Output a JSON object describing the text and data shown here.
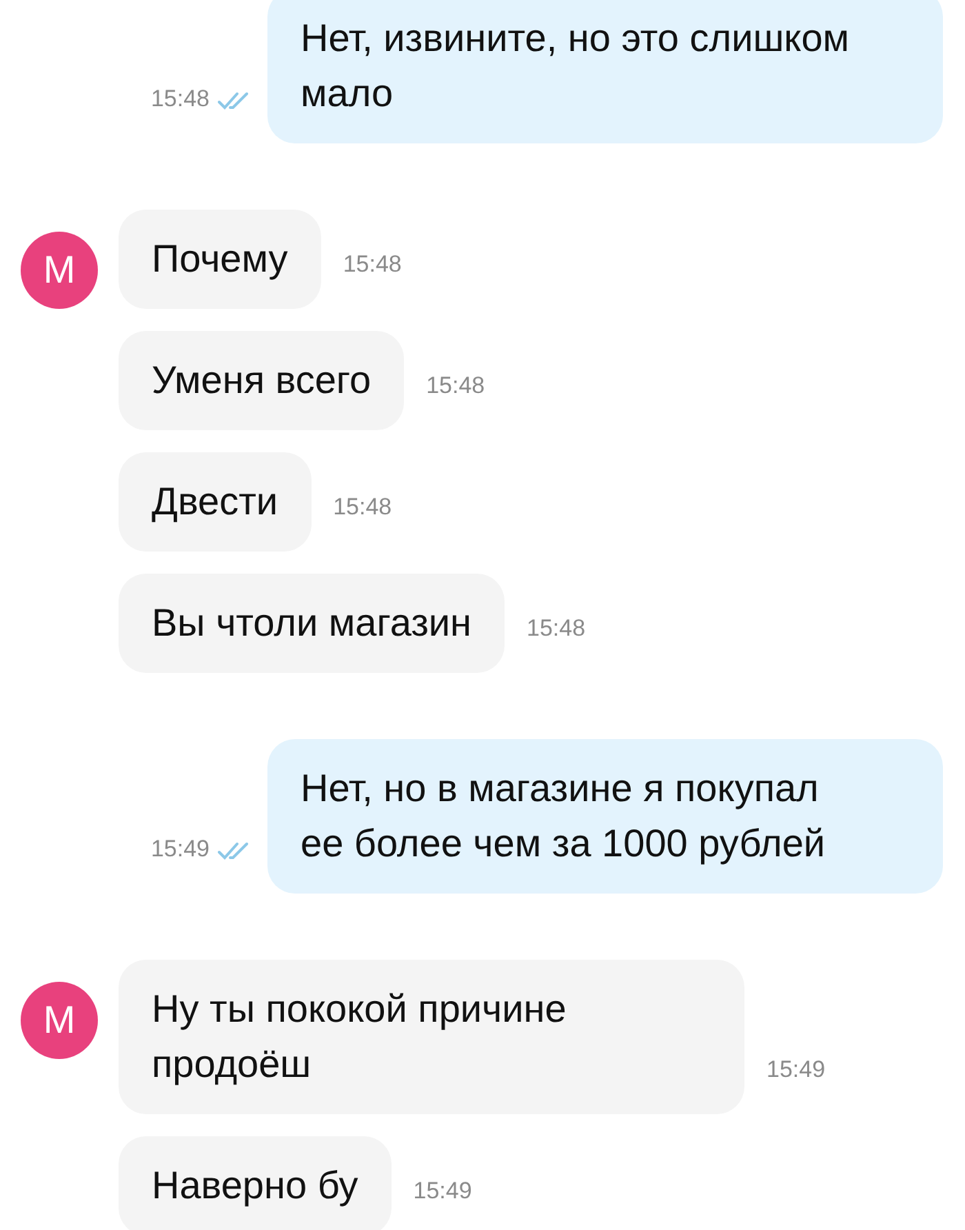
{
  "messages_groups": [
    {
      "kind": "outgoing",
      "messages": [
        {
          "text": "Нет, извините, но это слишком мало",
          "time": "15:48",
          "read": true
        }
      ]
    },
    {
      "kind": "incoming",
      "avatar": "M",
      "messages": [
        {
          "text": "Почему",
          "time": "15:48"
        },
        {
          "text": "Уменя всего",
          "time": "15:48"
        },
        {
          "text": "Двести",
          "time": "15:48"
        },
        {
          "text": "Вы чтоли магазин",
          "time": "15:48"
        }
      ]
    },
    {
      "kind": "outgoing",
      "messages": [
        {
          "text": "Нет, но в магазине я покупал ее более чем за 1000 рублей",
          "time": "15:49",
          "read": true
        }
      ]
    },
    {
      "kind": "incoming",
      "avatar": "M",
      "messages": [
        {
          "text": "Ну ты пококой причине продоёш",
          "time": "15:49"
        },
        {
          "text": "Наверно бу",
          "time": "15:49"
        }
      ]
    }
  ]
}
